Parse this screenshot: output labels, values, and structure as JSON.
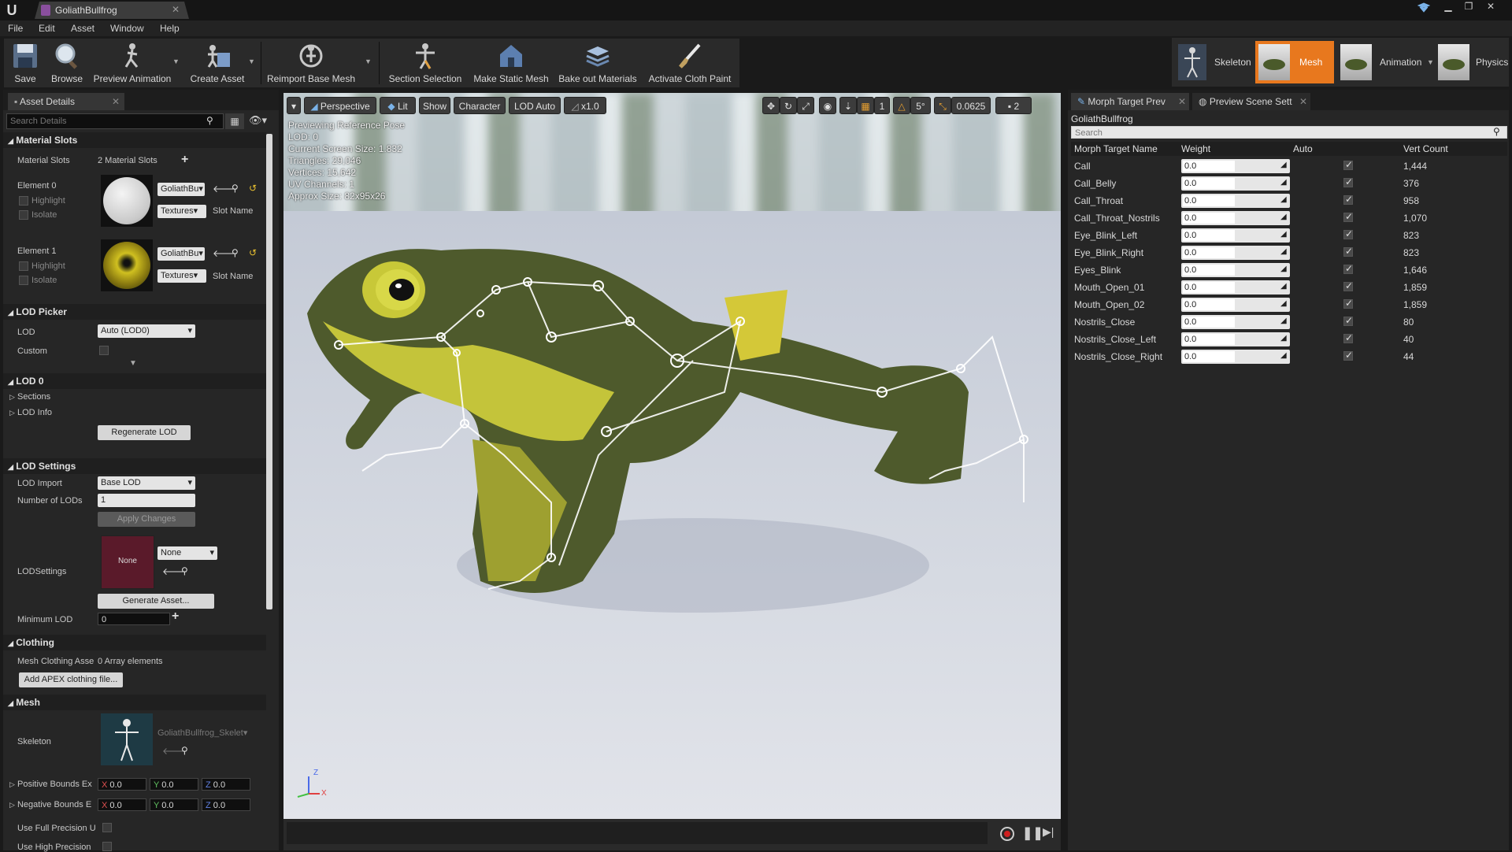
{
  "window": {
    "tab_title": "GoliathBullfrog",
    "logo": "U"
  },
  "menu": [
    "File",
    "Edit",
    "Asset",
    "Window",
    "Help"
  ],
  "toolbar": {
    "save": "Save",
    "browse": "Browse",
    "preview_animation": "Preview Animation",
    "create_asset": "Create Asset",
    "reimport": "Reimport Base Mesh",
    "section_selection": "Section Selection",
    "make_static_mesh": "Make Static Mesh",
    "bake_materials": "Bake out Materials",
    "activate_cloth": "Activate Cloth Paint"
  },
  "modes": {
    "skeleton": "Skeleton",
    "mesh": "Mesh",
    "animation": "Animation",
    "physics": "Physics",
    "active_color": "#e8781e"
  },
  "asset_details": {
    "tab": "Asset Details",
    "search_placeholder": "Search Details",
    "material_slots": {
      "header": "Material Slots",
      "label": "Material Slots",
      "count_text": "2 Material Slots",
      "elements": [
        {
          "label": "Element 0",
          "highlight": "Highlight",
          "isolate": "Isolate",
          "material": "GoliathBu",
          "textures": "Textures",
          "slot_name": "Slot Name"
        },
        {
          "label": "Element 1",
          "highlight": "Highlight",
          "isolate": "Isolate",
          "material": "GoliathBu",
          "textures": "Textures",
          "slot_name": "Slot Name"
        }
      ]
    },
    "lod_picker": {
      "header": "LOD Picker",
      "lod_label": "LOD",
      "lod_value": "Auto (LOD0)",
      "custom_label": "Custom"
    },
    "lod0": {
      "header": "LOD 0",
      "sections": "Sections",
      "lod_info": "LOD Info",
      "regenerate": "Regenerate LOD"
    },
    "lod_settings": {
      "header": "LOD Settings",
      "lod_import_label": "LOD Import",
      "lod_import_value": "Base LOD",
      "num_lods_label": "Number of LODs",
      "num_lods_value": "1",
      "apply": "Apply Changes",
      "lodsettings_label": "LODSettings",
      "thumb_none": "None",
      "select_value": "None",
      "generate": "Generate Asset...",
      "min_lod_label": "Minimum LOD",
      "min_lod_value": "0"
    },
    "clothing": {
      "header": "Clothing",
      "assets_label": "Mesh Clothing Asse",
      "assets_value": "0 Array elements",
      "add_apex": "Add APEX clothing file..."
    },
    "mesh": {
      "header": "Mesh",
      "skeleton_label": "Skeleton",
      "skeleton_value": "GoliathBullfrog_Skelet",
      "pos_bounds_label": "Positive Bounds Ex",
      "neg_bounds_label": "Negative Bounds E",
      "x_value": "0.0",
      "y_value": "0.0",
      "z_value": "0.0",
      "full_precision": "Use Full Precision U",
      "high_precision": "Use High Precision"
    }
  },
  "viewport": {
    "perspective": "Perspective",
    "lit": "Lit",
    "show": "Show",
    "character": "Character",
    "lod_auto": "LOD Auto",
    "speed": "x1.0",
    "angle_snap": "5°",
    "scale_snap": "0.0625",
    "camera_speed": "2",
    "warn": "1",
    "stats": [
      "Previewing Reference Pose",
      "LOD: 0",
      "Current Screen Size: 1.832",
      "Triangles: 29,046",
      "Vertices: 15,642",
      "UV Channels: 1",
      "Approx Size: 82x95x26"
    ],
    "axis_x": "X",
    "axis_z": "Z"
  },
  "morph_panel": {
    "tab1": "Morph Target Prev",
    "tab2": "Preview Scene Sett",
    "asset_name": "GoliathBullfrog",
    "search_placeholder": "Search",
    "columns": [
      "Morph Target Name",
      "Weight",
      "Auto",
      "Vert Count"
    ],
    "rows": [
      {
        "name": "Call",
        "weight": "0.0",
        "count": "1,444"
      },
      {
        "name": "Call_Belly",
        "weight": "0.0",
        "count": "376"
      },
      {
        "name": "Call_Throat",
        "weight": "0.0",
        "count": "958"
      },
      {
        "name": "Call_Throat_Nostrils",
        "weight": "0.0",
        "count": "1,070"
      },
      {
        "name": "Eye_Blink_Left",
        "weight": "0.0",
        "count": "823"
      },
      {
        "name": "Eye_Blink_Right",
        "weight": "0.0",
        "count": "823"
      },
      {
        "name": "Eyes_Blink",
        "weight": "0.0",
        "count": "1,646"
      },
      {
        "name": "Mouth_Open_01",
        "weight": "0.0",
        "count": "1,859"
      },
      {
        "name": "Mouth_Open_02",
        "weight": "0.0",
        "count": "1,859"
      },
      {
        "name": "Nostrils_Close",
        "weight": "0.0",
        "count": "80"
      },
      {
        "name": "Nostrils_Close_Left",
        "weight": "0.0",
        "count": "40"
      },
      {
        "name": "Nostrils_Close_Right",
        "weight": "0.0",
        "count": "44"
      }
    ]
  }
}
